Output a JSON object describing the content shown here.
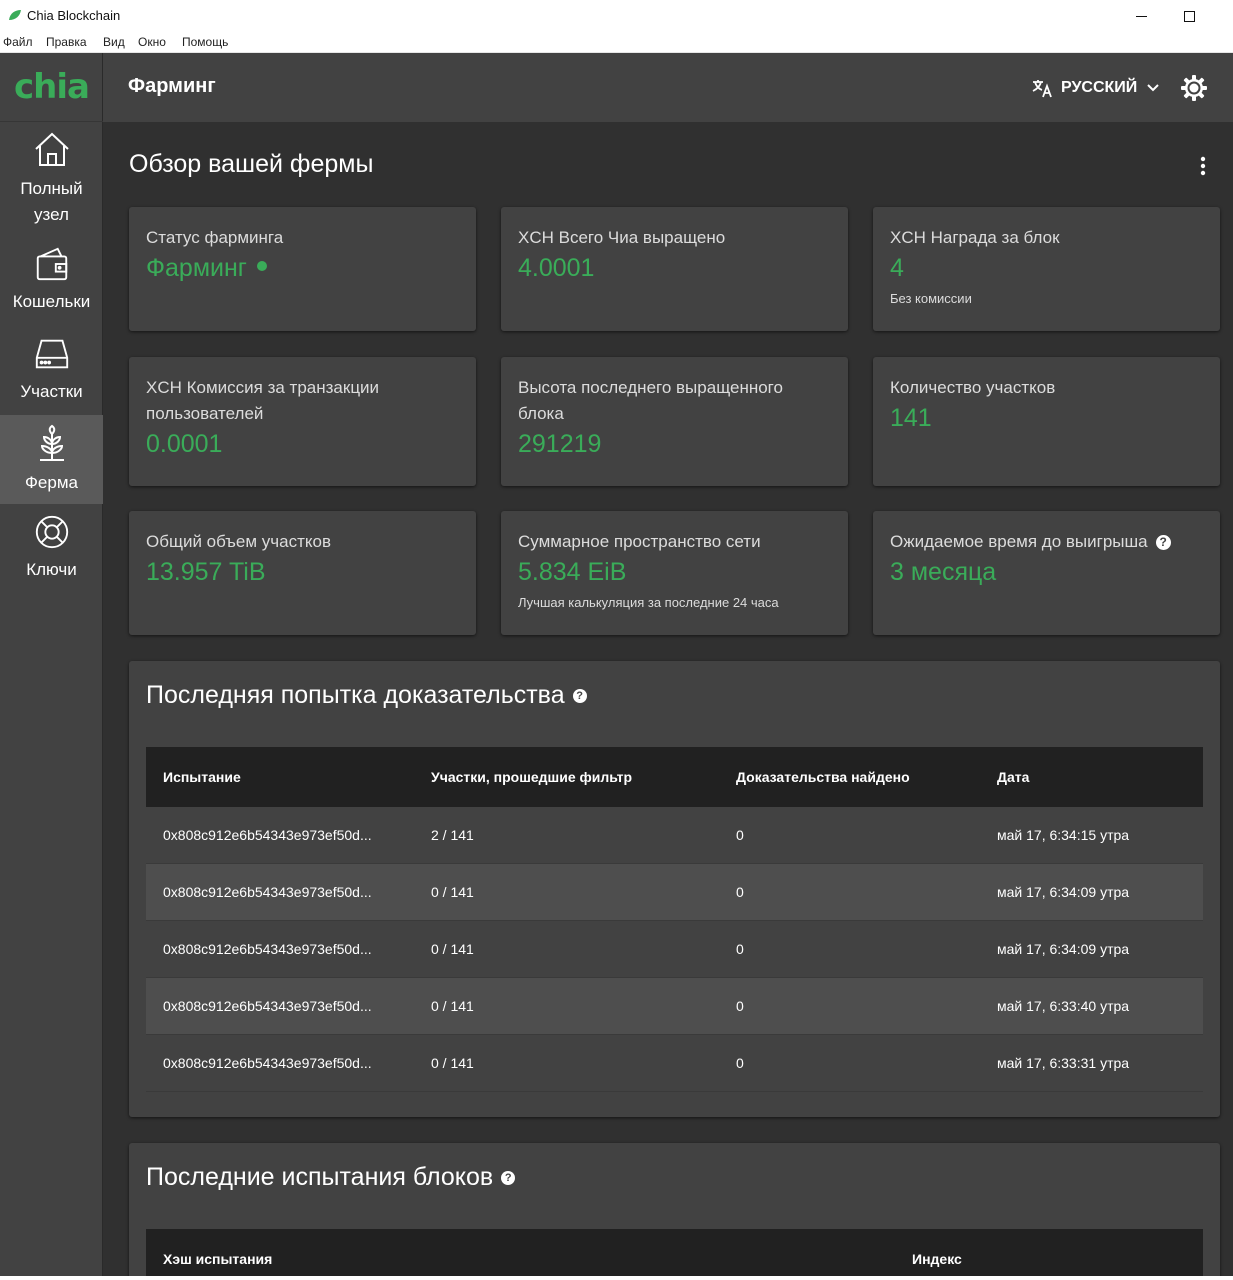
{
  "window": {
    "title": "Chia Blockchain"
  },
  "menu": [
    "Файл",
    "Правка",
    "Вид",
    "Окно",
    "Помощь"
  ],
  "logo": "chia",
  "sidebar": {
    "items": [
      {
        "label": "Полный узел",
        "icon": "home-icon"
      },
      {
        "label": "Кошельки",
        "icon": "wallet-icon"
      },
      {
        "label": "Участки",
        "icon": "plot-drive-icon"
      },
      {
        "label": "Ферма",
        "icon": "farm-sprout-icon",
        "active": true
      },
      {
        "label": "Ключи",
        "icon": "keys-lifebuoy-icon"
      }
    ]
  },
  "header": {
    "title": "Фарминг",
    "language": "РУССКИЙ"
  },
  "overview": {
    "title": "Обзор вашей фермы",
    "cards": [
      {
        "label": "Статус фарминга",
        "value": "Фарминг",
        "sub": ""
      },
      {
        "label": "XCH Всего Чиа выращено",
        "value": "4.0001",
        "sub": ""
      },
      {
        "label": "XCH Награда за блок",
        "value": "4",
        "sub": "Без комиссии"
      },
      {
        "label": "XCH Комиссия за транзакции пользователей",
        "value": "0.0001",
        "sub": ""
      },
      {
        "label": "Высота последнего выращенного блока",
        "value": "291219",
        "sub": ""
      },
      {
        "label": "Количество участков",
        "value": "141",
        "sub": ""
      },
      {
        "label": "Общий объем участков",
        "value": "13.957 TiB",
        "sub": ""
      },
      {
        "label": "Суммарное пространство сети",
        "value": "5.834 EiB",
        "sub": "Лучшая калькуляция за последние 24 часа"
      },
      {
        "label": "Ожидаемое время до выигрыша",
        "value": "3 месяца",
        "sub": ""
      }
    ]
  },
  "proofs": {
    "title": "Последняя попытка доказательства",
    "columns": [
      "Испытание",
      "Участки, прошедшие фильтр",
      "Доказательства найдено",
      "Дата"
    ],
    "rows": [
      [
        "0x808c912e6b54343e973ef50d...",
        "2 / 141",
        "0",
        "май 17, 6:34:15 утра"
      ],
      [
        "0x808c912e6b54343e973ef50d...",
        "0 / 141",
        "0",
        "май 17, 6:34:09 утра"
      ],
      [
        "0x808c912e6b54343e973ef50d...",
        "0 / 141",
        "0",
        "май 17, 6:34:09 утра"
      ],
      [
        "0x808c912e6b54343e973ef50d...",
        "0 / 141",
        "0",
        "май 17, 6:33:40 утра"
      ],
      [
        "0x808c912e6b54343e973ef50d...",
        "0 / 141",
        "0",
        "май 17, 6:33:31 утра"
      ]
    ]
  },
  "challenges": {
    "title": "Последние испытания блоков",
    "columns": [
      "Хэш испытания",
      "Индекс"
    ]
  },
  "colors": {
    "accent": "#3aac59",
    "background": "#303030",
    "card": "#424242",
    "table_header": "#212121"
  }
}
